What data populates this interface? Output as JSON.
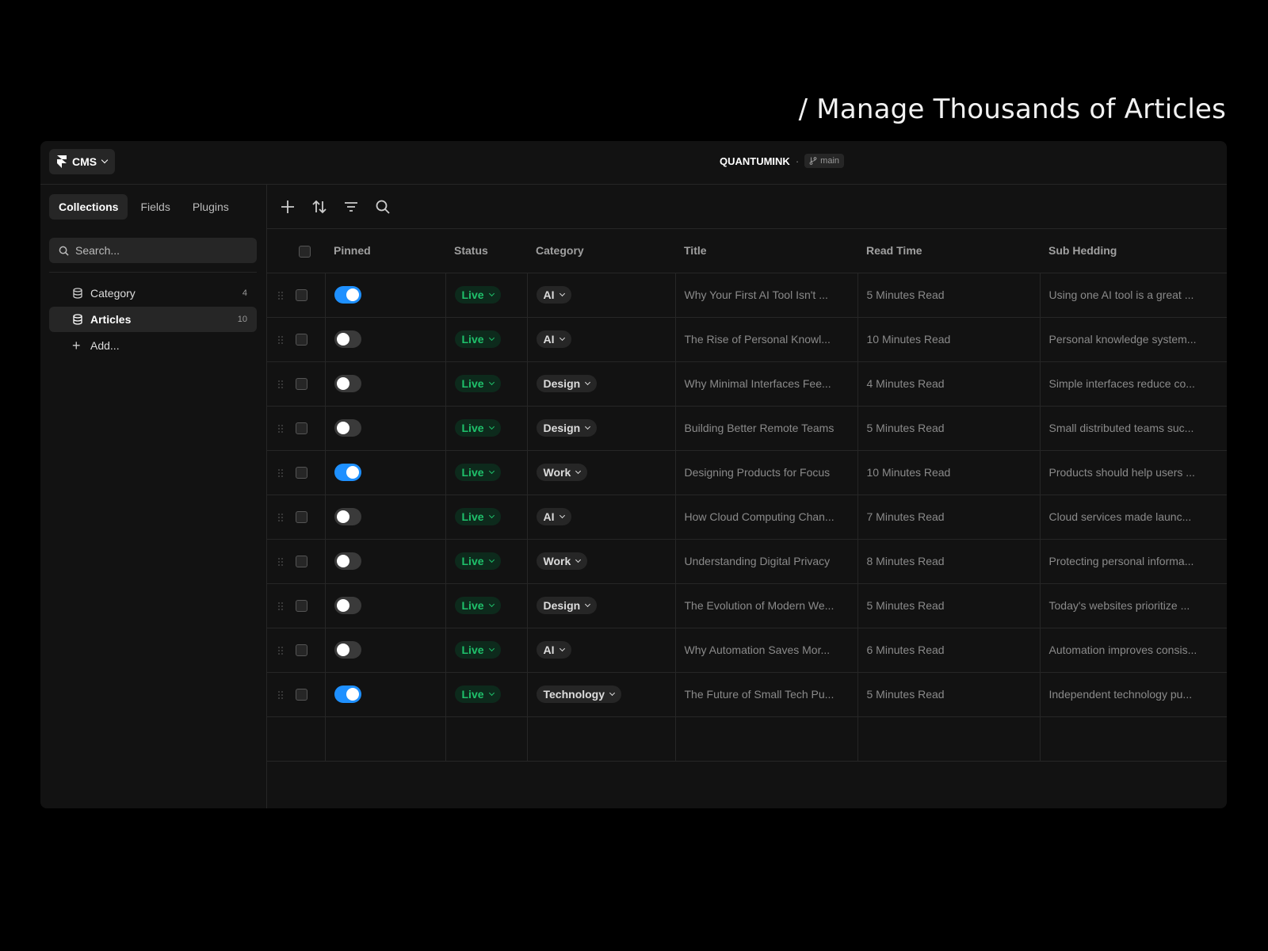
{
  "headline": "/ Manage Thousands of Articles",
  "topbar": {
    "app_menu_label": "CMS",
    "project_name": "QUANTUMINK",
    "separator": "·",
    "branch": "main"
  },
  "sidebar": {
    "tabs": [
      {
        "label": "Collections",
        "active": true
      },
      {
        "label": "Fields",
        "active": false
      },
      {
        "label": "Plugins",
        "active": false
      }
    ],
    "search_placeholder": "Search...",
    "collections": [
      {
        "label": "Category",
        "count": "4",
        "active": false
      },
      {
        "label": "Articles",
        "count": "10",
        "active": true
      }
    ],
    "add_label": "Add..."
  },
  "toolbar": {
    "icons": [
      "plus-icon",
      "sort-icon",
      "filter-icon",
      "search-icon"
    ]
  },
  "table": {
    "columns": [
      "Pinned",
      "Status",
      "Category",
      "Title",
      "Read Time",
      "Sub Hedding"
    ],
    "rows": [
      {
        "pinned": true,
        "status": "Live",
        "category": "AI",
        "title": "Why Your First AI Tool Isn't ...",
        "read_time": "5 Minutes Read",
        "sub": "Using one AI tool is a great ..."
      },
      {
        "pinned": false,
        "status": "Live",
        "category": "AI",
        "title": "The Rise of Personal Knowl...",
        "read_time": "10 Minutes Read",
        "sub": "Personal knowledge system..."
      },
      {
        "pinned": false,
        "status": "Live",
        "category": "Design",
        "title": "Why Minimal Interfaces Fee...",
        "read_time": "4 Minutes Read",
        "sub": "Simple interfaces reduce co..."
      },
      {
        "pinned": false,
        "status": "Live",
        "category": "Design",
        "title": "Building Better Remote Teams",
        "read_time": "5 Minutes Read",
        "sub": "Small distributed teams suc..."
      },
      {
        "pinned": true,
        "status": "Live",
        "category": "Work",
        "title": "Designing Products for Focus",
        "read_time": "10 Minutes Read",
        "sub": "Products should help users ..."
      },
      {
        "pinned": false,
        "status": "Live",
        "category": "AI",
        "title": "How Cloud Computing Chan...",
        "read_time": "7 Minutes Read",
        "sub": "Cloud services made launc..."
      },
      {
        "pinned": false,
        "status": "Live",
        "category": "Work",
        "title": "Understanding Digital Privacy",
        "read_time": "8 Minutes Read",
        "sub": "Protecting personal informa..."
      },
      {
        "pinned": false,
        "status": "Live",
        "category": "Design",
        "title": "The Evolution of Modern We...",
        "read_time": "5 Minutes Read",
        "sub": "Today's websites prioritize ..."
      },
      {
        "pinned": false,
        "status": "Live",
        "category": "AI",
        "title": "Why Automation Saves Mor...",
        "read_time": "6 Minutes Read",
        "sub": "Automation improves consis..."
      },
      {
        "pinned": true,
        "status": "Live",
        "category": "Technology",
        "title": "The Future of Small Tech Pu...",
        "read_time": "5 Minutes Read",
        "sub": "Independent technology pu..."
      }
    ]
  },
  "colors": {
    "background": "#000000",
    "panel": "#121212",
    "toggle_on": "#1e90ff",
    "status_live": "#1fc16b"
  }
}
